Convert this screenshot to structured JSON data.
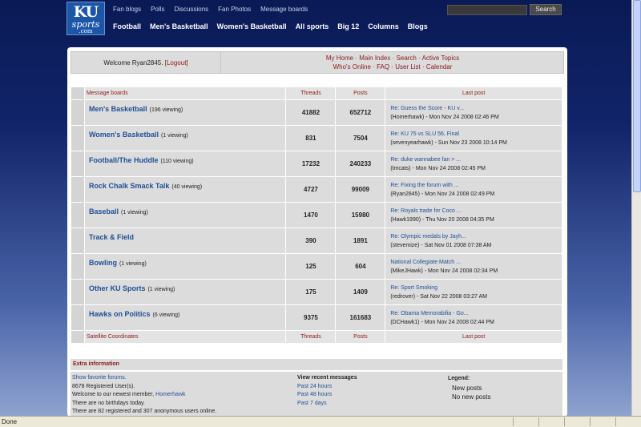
{
  "site": {
    "logo_ku": "KU",
    "logo_sports": "sports",
    "logo_com": ".com"
  },
  "topnav": [
    "Fan blogs",
    "Polls",
    "Discussions",
    "Fan Photos",
    "Message boards"
  ],
  "search": {
    "button_label": "Search",
    "value": ""
  },
  "mainnav": [
    "Football",
    "Men's Basketball",
    "Women's Basketball",
    "All sports",
    "Big 12",
    "Columns",
    "Blogs"
  ],
  "welcome": {
    "text": "Welcome Ryan2845.",
    "logout": "[Logout]"
  },
  "quicklinks": {
    "row1": [
      "My Home",
      "Main Index",
      "Search",
      "Active Topics"
    ],
    "row2": [
      "Who's Online",
      "FAQ",
      "User List",
      "Calendar"
    ],
    "separator": "·"
  },
  "table": {
    "header": {
      "board": "Message boards",
      "threads": "Threads",
      "posts": "Posts",
      "last": "Last post"
    },
    "footer": {
      "board": "Satellite Coordinates",
      "threads": "Threads",
      "posts": "Posts",
      "last": "Last post"
    },
    "rows": [
      {
        "name": "Men's Basketball",
        "viewing": "(196 viewing)",
        "threads": "41882",
        "posts": "652712",
        "last_title": "Re: Guess the Score - KU v...",
        "last_by": "(Homerhawk) - Mon Nov 24 2008 02:46 PM"
      },
      {
        "name": "Women's Basketball",
        "viewing": "(1 viewing)",
        "threads": "831",
        "posts": "7504",
        "last_title": "Re: KU 75 vs SLU 56, Final",
        "last_by": "(sevenyearhawk) - Sun Nov 23 2008 10:14 PM"
      },
      {
        "name": "Football/The Huddle",
        "viewing": "(110 viewing)",
        "threads": "17232",
        "posts": "240233",
        "last_title": "Re: duke wannabee fan > ...",
        "last_by": "(tmcats) - Mon Nov 24 2008 02:45 PM"
      },
      {
        "name": "Rock Chalk Smack Talk",
        "viewing": "(40 viewing)",
        "threads": "4727",
        "posts": "99009",
        "last_title": "Re: Fixing the forum with ...",
        "last_by": "(Ryan2845) - Mon Nov 24 2008 02:49 PM"
      },
      {
        "name": "Baseball",
        "viewing": "(1 viewing)",
        "threads": "1470",
        "posts": "15980",
        "last_title": "Re: Royals trade for Coco ...",
        "last_by": "(Hawk1990) - Thu Nov 20 2008 04:35 PM"
      },
      {
        "name": "Track & Field",
        "viewing": "",
        "threads": "390",
        "posts": "1891",
        "last_title": "Re: Olympic medals by Jayh...",
        "last_by": "(stevemize) - Sat Nov 01 2008 07:38 AM"
      },
      {
        "name": "Bowling",
        "viewing": "(1 viewing)",
        "threads": "125",
        "posts": "604",
        "last_title": "National Collegiate Match ...",
        "last_by": "(MikeJHawk) - Mon Nov 24 2008 02:34 PM"
      },
      {
        "name": "Other KU Sports",
        "viewing": "(1 viewing)",
        "threads": "175",
        "posts": "1409",
        "last_title": "Re: Sport Smoking",
        "last_by": "(redrover) - Sat Nov 22 2008 03:27 AM"
      },
      {
        "name": "Hawks on Politics",
        "viewing": "(6 viewing)",
        "threads": "9375",
        "posts": "161683",
        "last_title": "Re: Obama Memorabilia - Go...",
        "last_by": "(DCHawk1) - Mon Nov 24 2008 02:44 PM"
      }
    ]
  },
  "extra": {
    "heading": "Extra information",
    "show_favorites": "Show favorite forums.",
    "registered": "8678 Registered User(s).",
    "newest_prefix": "Welcome to our newest member,",
    "newest_member": "Homerhawk",
    "birthdays": "There are no birthdays today.",
    "online": "There are 82 registered and 307 anonymous users online.",
    "recent_heading": "View recent messages",
    "recent_links": [
      "Past 24 hours",
      "Past 48 hours",
      "Past 7 days"
    ],
    "legend_heading": "Legend:",
    "legend_items": [
      "New posts",
      "No new posts"
    ]
  },
  "statusbar": {
    "text": "Done"
  }
}
